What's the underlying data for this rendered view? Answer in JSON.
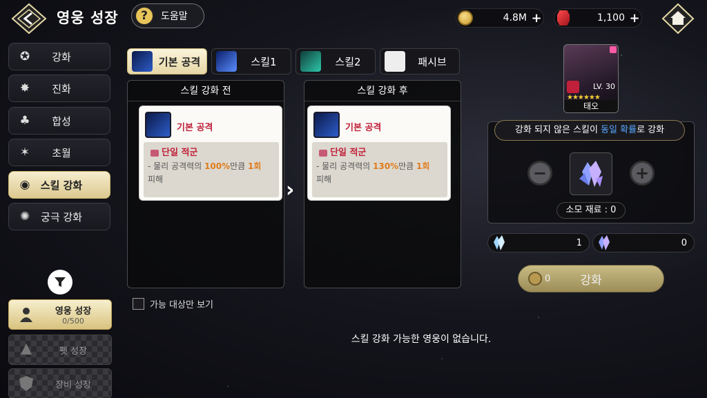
{
  "header": {
    "title": "영웅 성장",
    "help_label": "도움말",
    "gold": "4.8M",
    "gems": "1,100"
  },
  "sidebar": {
    "items": [
      {
        "label": "강화",
        "icon": "enhance-icon"
      },
      {
        "label": "진화",
        "icon": "evolve-icon"
      },
      {
        "label": "합성",
        "icon": "combine-icon"
      },
      {
        "label": "초월",
        "icon": "transcend-icon"
      },
      {
        "label": "스킬 강화",
        "icon": "skill-enhance-icon",
        "active": true
      },
      {
        "label": "궁극 강화",
        "icon": "ultimate-enhance-icon"
      }
    ]
  },
  "bottom_tabs": [
    {
      "label": "영웅 성장",
      "sub": "0/500",
      "active": true
    },
    {
      "label": "펫 성장"
    },
    {
      "label": "장비 성장"
    }
  ],
  "skill_tabs": [
    {
      "label": "기본 공격",
      "active": true
    },
    {
      "label": "스킬1"
    },
    {
      "label": "스킬2"
    },
    {
      "label": "패시브"
    }
  ],
  "before": {
    "header": "스킬 강화 전",
    "name": "기본 공격",
    "target": "단일 적군",
    "desc_prefix": "- 물리 공격력의 ",
    "desc_pct": "100%",
    "desc_mid": "만큼 ",
    "desc_hits": "1회",
    "desc_suffix": "피해"
  },
  "after": {
    "header": "스킬 강화 후",
    "name": "기본 공격",
    "target": "단일 적군",
    "desc_prefix": "- 물리 공격력의 ",
    "desc_pct": "130%",
    "desc_mid": "만큼 ",
    "desc_hits": "1회",
    "desc_suffix": "피해"
  },
  "filter_checkbox_label": "가능 대상만 보기",
  "empty_message": "스킬 강화 가능한 영웅이 없습니다.",
  "hero": {
    "level": "LV. 30",
    "name": "태오",
    "stars": "★★★★★★"
  },
  "enhance": {
    "banner_prefix": "강화 되지 않은 스킬이 ",
    "banner_highlight": "동일 확률",
    "banner_suffix": "로 강화",
    "cost_label": "소모 재료 : 0",
    "material_1_count": "1",
    "material_2_count": "0",
    "button_cost": "0",
    "button_label": "강화"
  }
}
